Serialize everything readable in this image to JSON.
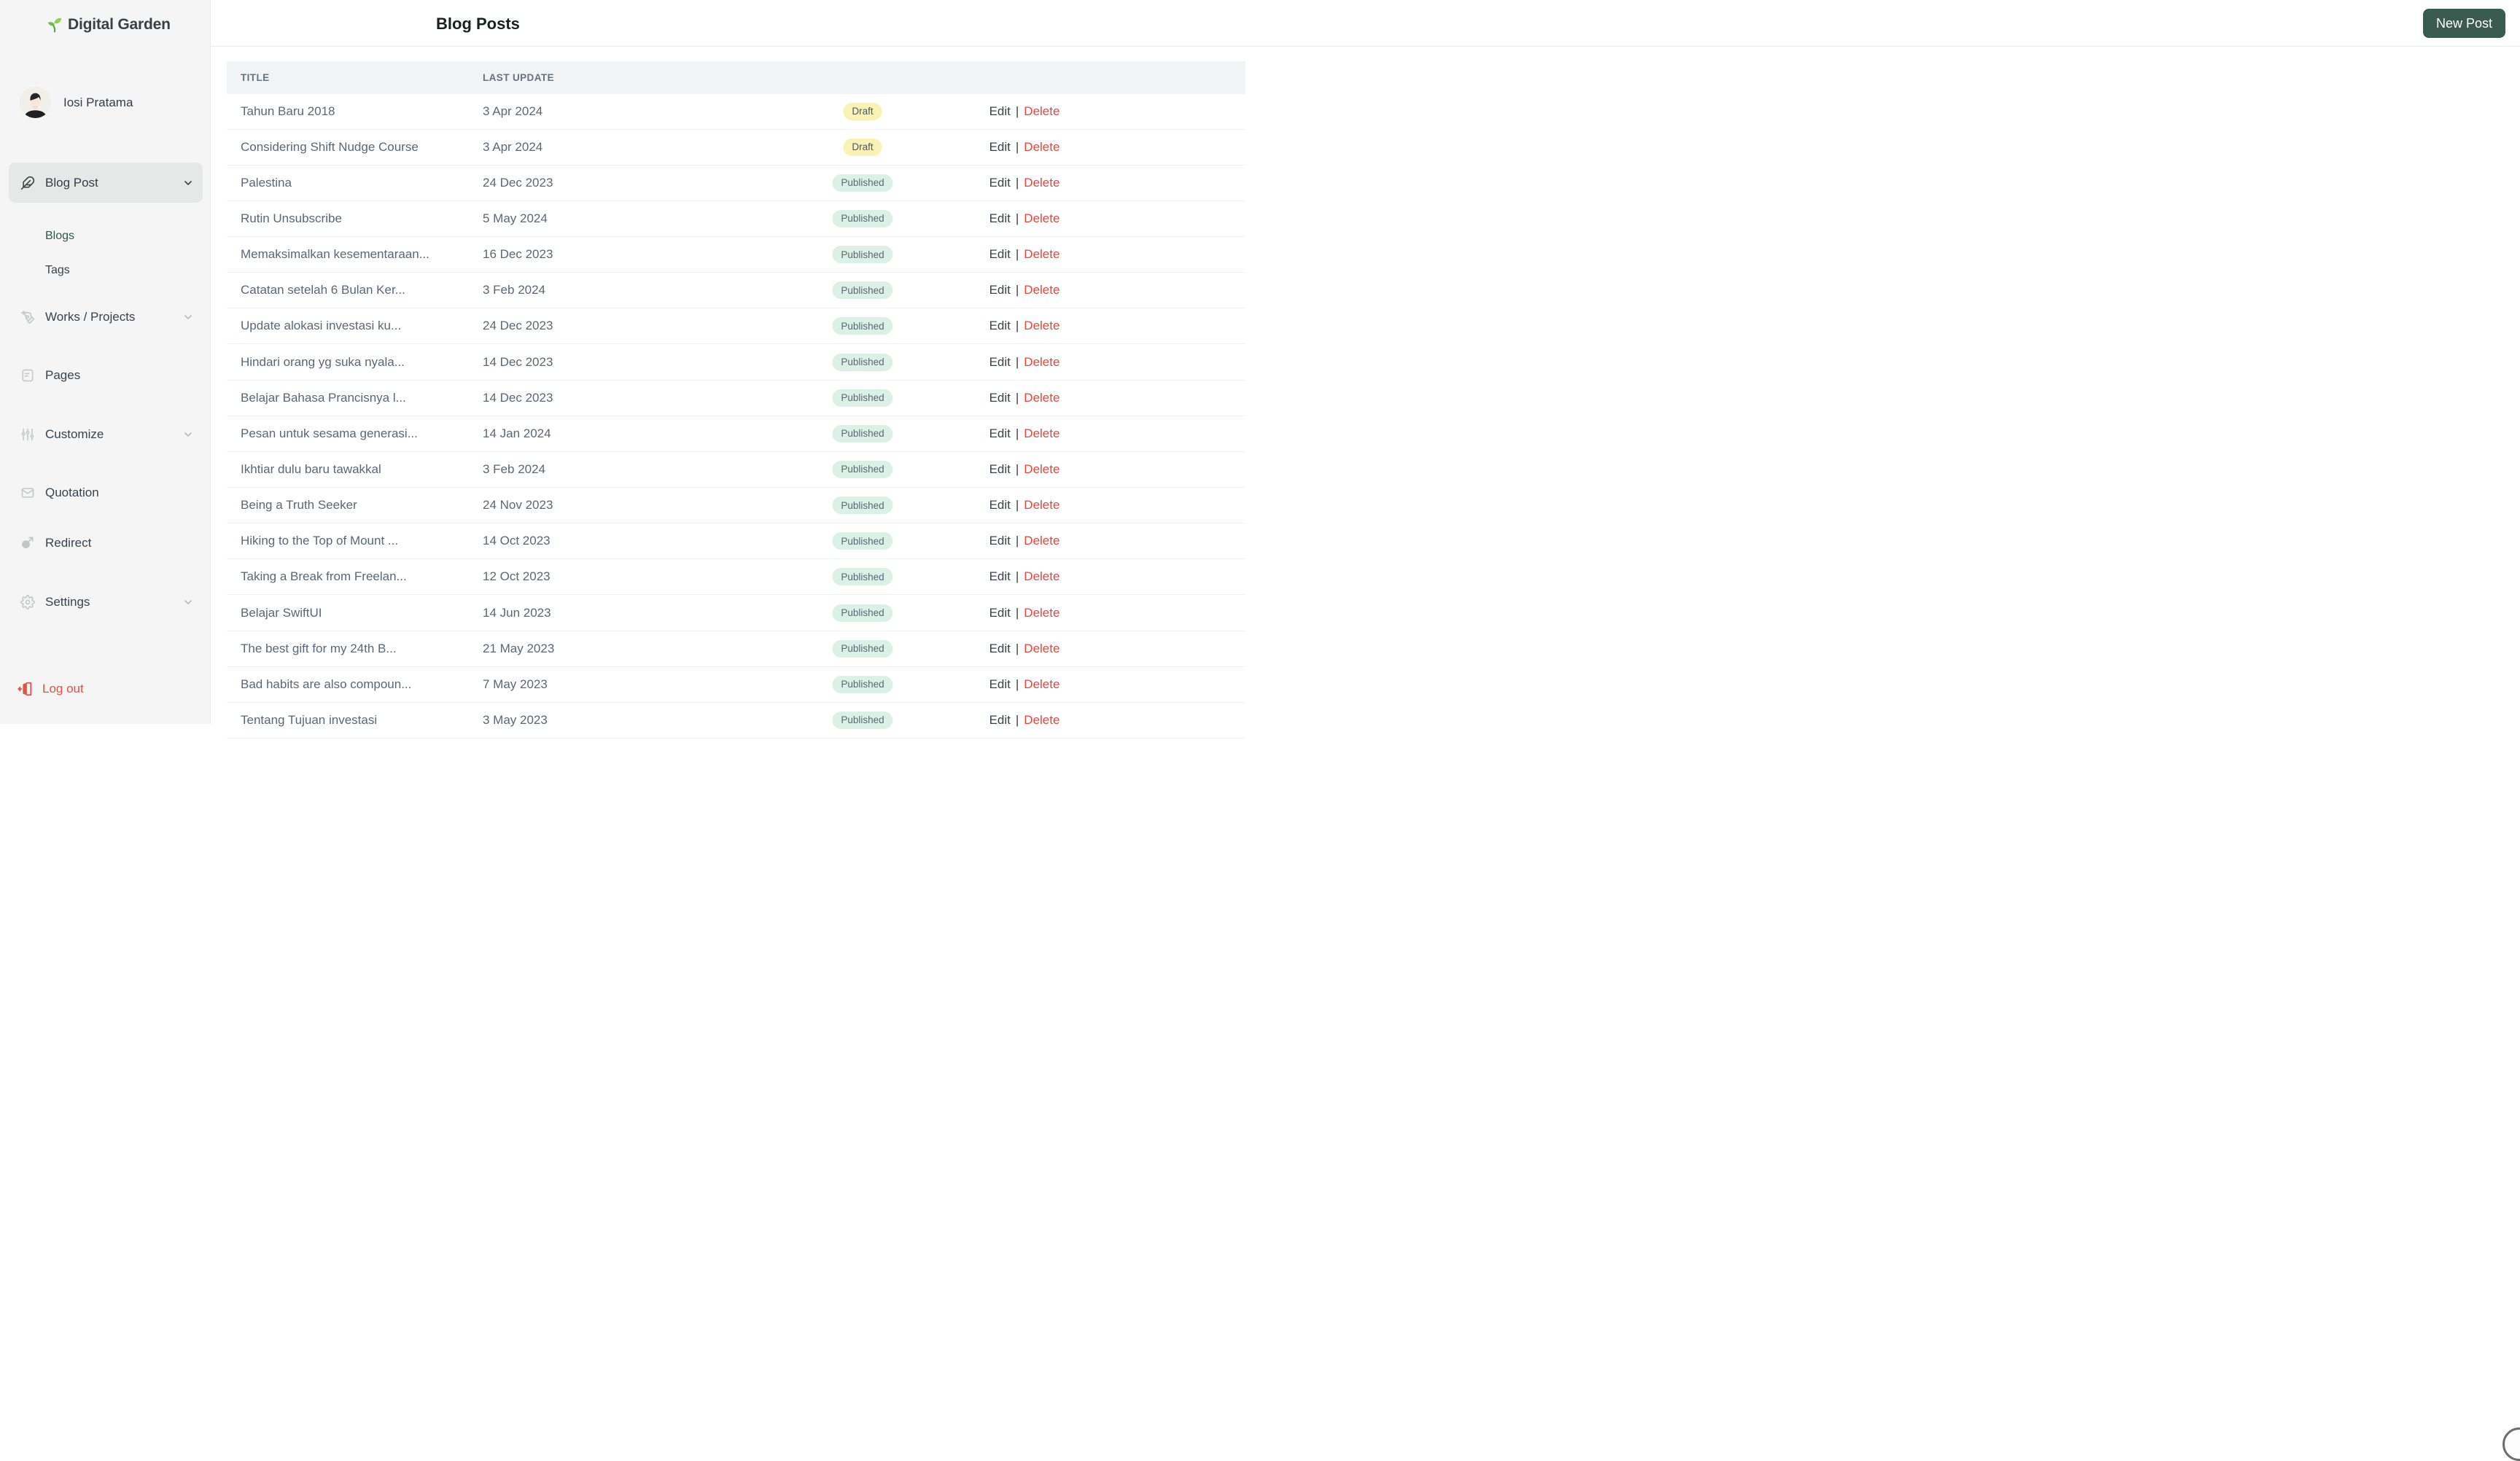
{
  "app": {
    "name": "Digital Garden"
  },
  "user": {
    "name": "Iosi Pratama"
  },
  "sidebar": {
    "items": [
      {
        "label": "Blog Post",
        "icon": "feather-icon",
        "active": true,
        "expandable": true
      },
      {
        "label": "Blogs",
        "type": "sub-item",
        "active": true
      },
      {
        "label": "Tags",
        "type": "sub-item"
      },
      {
        "label": "Works / Projects",
        "icon": "pen-tool-icon",
        "expandable": true
      },
      {
        "label": "Pages",
        "icon": "document-icon"
      },
      {
        "label": "Customize",
        "icon": "sliders-icon",
        "expandable": true
      },
      {
        "label": "Quotation",
        "icon": "envelope-icon"
      },
      {
        "label": "Redirect",
        "icon": "redirect-icon"
      },
      {
        "label": "Settings",
        "icon": "gear-icon",
        "expandable": true
      }
    ],
    "logout_label": "Log out"
  },
  "header": {
    "title": "Blog Posts",
    "new_post_label": "New Post"
  },
  "table": {
    "columns": [
      "TITLE",
      "LAST UPDATE"
    ],
    "actions": {
      "edit": "Edit",
      "separator": "|",
      "delete": "Delete"
    },
    "rows": [
      {
        "title": "Tahun Baru 2018",
        "last_update": "3 Apr 2024",
        "status": "Draft"
      },
      {
        "title": "Considering Shift Nudge Course",
        "last_update": "3 Apr 2024",
        "status": "Draft"
      },
      {
        "title": "Palestina",
        "last_update": "24 Dec 2023",
        "status": "Published"
      },
      {
        "title": "Rutin Unsubscribe",
        "last_update": "5 May 2024",
        "status": "Published"
      },
      {
        "title": "Memaksimalkan kesementaraan...",
        "last_update": "16 Dec 2023",
        "status": "Published"
      },
      {
        "title": "Catatan setelah 6 Bulan Ker...",
        "last_update": "3 Feb 2024",
        "status": "Published"
      },
      {
        "title": "Update alokasi investasi ku...",
        "last_update": "24 Dec 2023",
        "status": "Published"
      },
      {
        "title": "Hindari orang yg suka nyala...",
        "last_update": "14 Dec 2023",
        "status": "Published"
      },
      {
        "title": "Belajar Bahasa Prancisnya l...",
        "last_update": "14 Dec 2023",
        "status": "Published"
      },
      {
        "title": "Pesan untuk sesama generasi...",
        "last_update": "14 Jan 2024",
        "status": "Published"
      },
      {
        "title": "Ikhtiar dulu baru tawakkal",
        "last_update": "3 Feb 2024",
        "status": "Published"
      },
      {
        "title": "Being a Truth Seeker",
        "last_update": "24 Nov 2023",
        "status": "Published"
      },
      {
        "title": "Hiking to the Top of Mount ...",
        "last_update": "14 Oct 2023",
        "status": "Published"
      },
      {
        "title": "Taking a Break from Freelan...",
        "last_update": "12 Oct 2023",
        "status": "Published"
      },
      {
        "title": "Belajar SwiftUI",
        "last_update": "14 Jun 2023",
        "status": "Published"
      },
      {
        "title": "The best gift for my 24th B...",
        "last_update": "21 May 2023",
        "status": "Published"
      },
      {
        "title": "Bad habits are also compoun...",
        "last_update": "7 May 2023",
        "status": "Published"
      },
      {
        "title": "Tentang Tujuan investasi",
        "last_update": "3 May 2023",
        "status": "Published"
      }
    ]
  },
  "colors": {
    "sidebar_bg": "#F4F5F4",
    "sidebar_active_bg": "#E5E8E7",
    "active_sub_link_green": "#2E5A4C",
    "button_green": "#3A5B4F",
    "logout_red": "#E05248",
    "delete_red": "#E2463C",
    "draft_badge_bg": "#F8F3B4",
    "published_badge_bg": "#DBF1E6",
    "table_header_bg": "#F2F3F5",
    "row_text": "#5A6876",
    "logo_leaf_green": "#8ED14F"
  }
}
